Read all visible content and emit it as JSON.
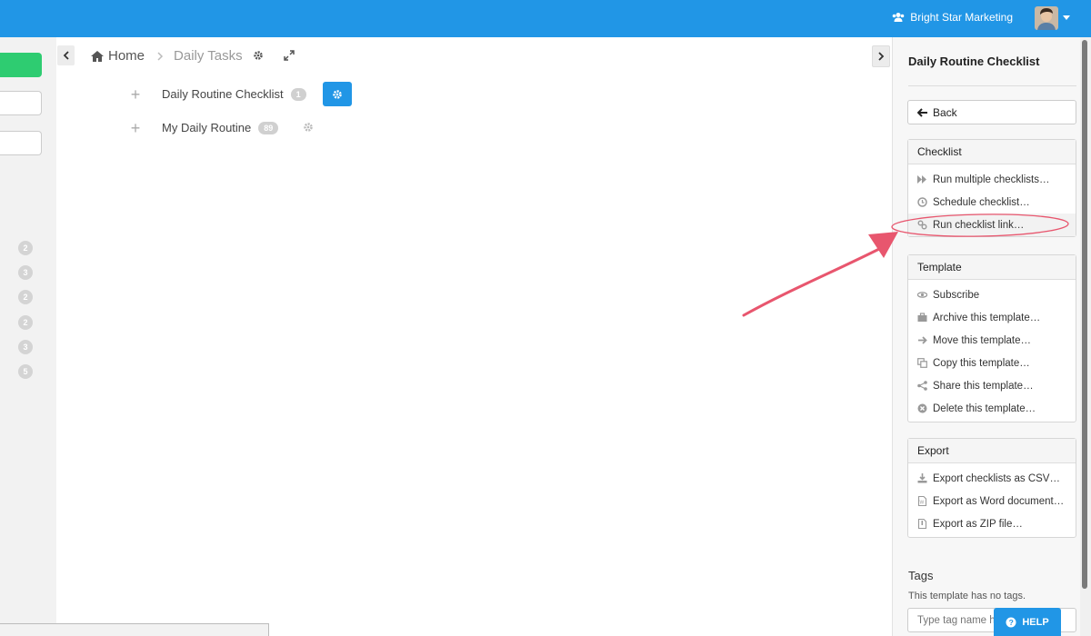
{
  "topbar": {
    "org_name": "Bright Star Marketing"
  },
  "left_sidebar": {
    "badges": [
      "2",
      "3",
      "2",
      "2",
      "3",
      "5"
    ]
  },
  "breadcrumb": {
    "home": "Home",
    "current": "Daily Tasks"
  },
  "templates": [
    {
      "name": "Daily Routine Checklist",
      "count": "1"
    },
    {
      "name": "My Daily Routine",
      "count": "89"
    }
  ],
  "panel": {
    "title": "Daily Routine Checklist",
    "back_label": "Back",
    "checklist": {
      "header": "Checklist",
      "items": [
        "Run multiple checklists…",
        "Schedule checklist…",
        "Run checklist link…"
      ]
    },
    "template": {
      "header": "Template",
      "items": [
        "Subscribe",
        "Archive this template…",
        "Move this template…",
        "Copy this template…",
        "Share this template…",
        "Delete this template…"
      ]
    },
    "export": {
      "header": "Export",
      "items": [
        "Export checklists as CSV…",
        "Export as Word document…",
        "Export as ZIP file…"
      ]
    },
    "tags": {
      "title": "Tags",
      "note": "This template has no tags.",
      "placeholder": "Type tag name h"
    },
    "help_label": "HELP"
  },
  "colors": {
    "topbar": "#2196e6",
    "accent_green": "#2ecc71",
    "annotation": "#e8566e"
  }
}
